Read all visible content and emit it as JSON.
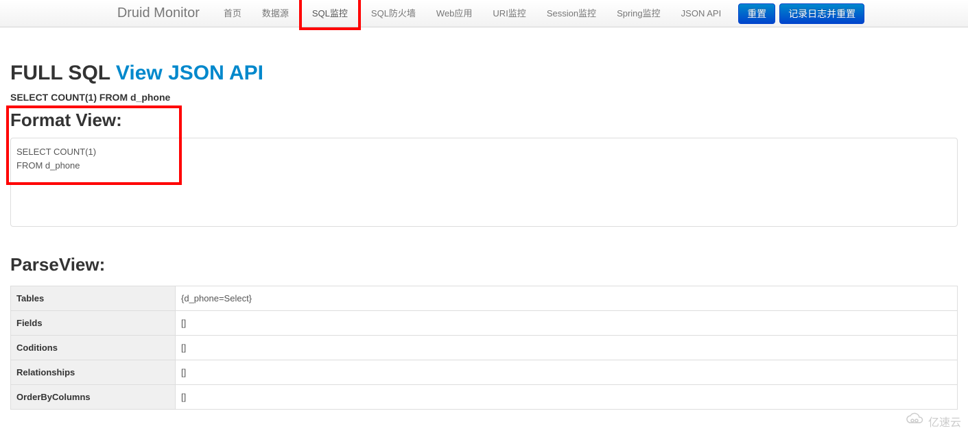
{
  "navbar": {
    "brand": "Druid Monitor",
    "items": [
      {
        "label": "首页"
      },
      {
        "label": "数据源"
      },
      {
        "label": "SQL监控",
        "highlighted": true
      },
      {
        "label": "SQL防火墙"
      },
      {
        "label": "Web应用"
      },
      {
        "label": "URI监控"
      },
      {
        "label": "Session监控"
      },
      {
        "label": "Spring监控"
      },
      {
        "label": "JSON API"
      }
    ],
    "buttons": {
      "reset": "重置",
      "logAndReset": "记录日志并重置"
    }
  },
  "fullSql": {
    "title": "FULL SQL ",
    "link": "View JSON API",
    "sql": "SELECT COUNT(1) FROM d_phone"
  },
  "formatView": {
    "title": "Format View:",
    "content": "SELECT COUNT(1)\nFROM d_phone"
  },
  "parseView": {
    "title": "ParseView:",
    "rows": [
      {
        "label": "Tables",
        "value": "{d_phone=Select}"
      },
      {
        "label": "Fields",
        "value": "[]"
      },
      {
        "label": "Coditions",
        "value": "[]"
      },
      {
        "label": "Relationships",
        "value": "[]"
      },
      {
        "label": "OrderByColumns",
        "value": "[]"
      }
    ]
  },
  "watermark": "亿速云"
}
